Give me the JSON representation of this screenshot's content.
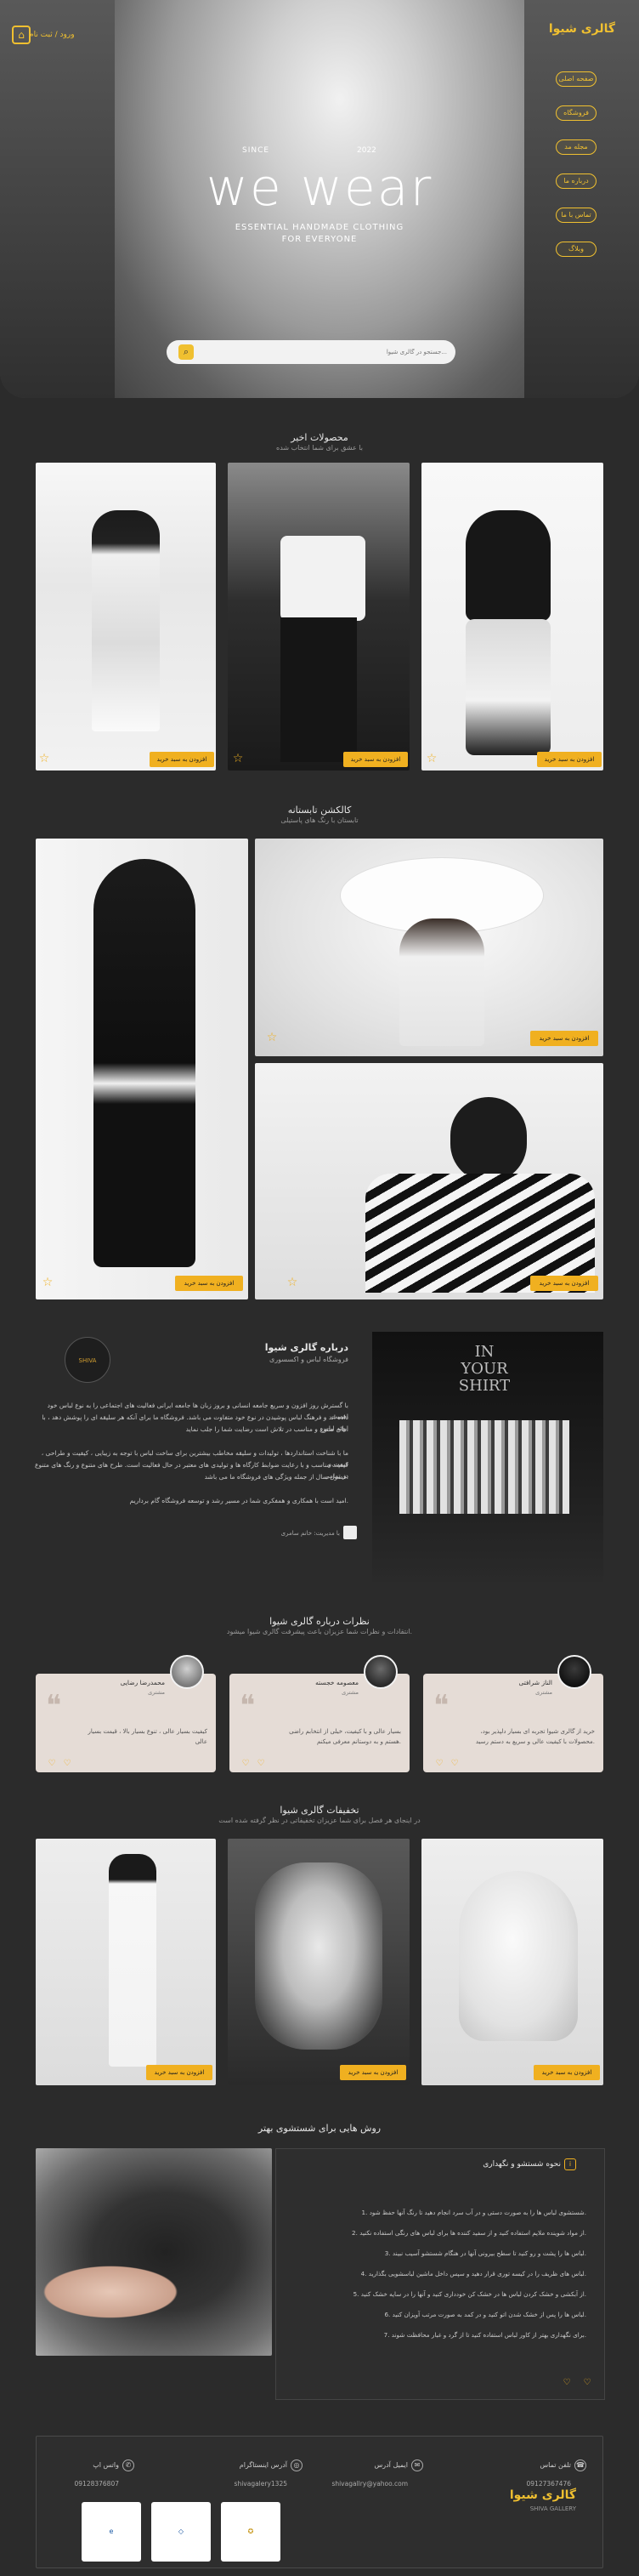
{
  "brand": {
    "name": "گالری شیوا",
    "tagline": "SHIVA"
  },
  "colors": {
    "accent": "#f0b020",
    "bg": "#2b2b2b",
    "card": "#e5dcd6"
  },
  "hero": {
    "signin": "ورود / ثبت نام",
    "cart_icon": "cart-icon",
    "nav": [
      "صفحه اصلی",
      "فروشگاه",
      "مجله مد",
      "درباره ما",
      "تماس با ما",
      "وبلاگ"
    ],
    "since": "SINCE",
    "year": "2022",
    "title": "we wear",
    "sub1": "ESSENTIAL HANDMADE CLOTHING",
    "sub2": "FOR EVERYONE",
    "search_placeholder": "جستجو در گالری شیوا..."
  },
  "latest": {
    "title": "محصولات اخیر",
    "subtitle": "با عشق برای شما انتخاب شده",
    "cta": "افزودن به سبد خرید"
  },
  "collection": {
    "title": "کالکشن تابستانه",
    "subtitle": "تابستان با رنگ های پاستیلی",
    "cta": "افزودن به سبد خرید"
  },
  "about": {
    "logo": "SHIVA",
    "title": "درباره گالری شیوا",
    "subtitle": "فروشگاه لباس و اکسسوری",
    "p1": "با گسترش روز افزون و سریع جامعه انسانی و بروز زبان ها جامعه ایرانی فعالیت های اجتماعی را به نوع لباس خود اهمیت",
    "p2": "داده اند و فرهنگ لباس پوشیدن در نوع خود متفاوت می باشد. فروشگاه ما برای آنکه هر سلیقه ای را پوشش دهد ، با ارائه لباس",
    "p3": "های متنوع و مناسب در تلاش است رضایت شما را جلب نماید.",
    "p4": "ما با شناخت استانداردها ، تولیدات و سلیقه مخاطب بیشترین برای ساخت لباس با توجه به زیبایی ، کیفیت و طراحی ، قیمت و",
    "p5": "کیفیت مناسب و با رعایت ضوابط کارگاه ها و تولیدی های معتبر در حال فعالیت است. طرح های متنوع و رنگ های متنوع در تمامی",
    "p6": "فصول سال از جمله ویژگی های فروشگاه ما می باشد.",
    "p7": "امید است با همکاری و همفکری شما در مسیر رشد و توسعه فروشگاه گام برداریم.",
    "author": "با مدیریت: خانم سامری"
  },
  "comments": {
    "title": "نظرات درباره گالری شیوا",
    "subtitle": "انتقادات و نظرات شما عزیزان باعث پیشرفت گالری شیوا میشود.",
    "items": [
      {
        "name": "الناز شرافتی",
        "role": "مشتری",
        "text": "خرید از گالری شیوا تجربه ای بسیار دلپذیر بود، محصولات با کیفیت عالی و سریع به دستم رسید."
      },
      {
        "name": "معصومه خجسته",
        "role": "مشتری",
        "text": "بسیار عالی و با کیفیت، خیلی از انتخابم راضی هستم و به دوستانم معرفی میکنم."
      },
      {
        "name": "محمدرضا رضایی",
        "role": "مشتری",
        "text": "کیفیت بسیار عالی ، تنوع بسیار بالا ، قیمت بسیار عالی"
      }
    ]
  },
  "discounts": {
    "title": "تخفیفات گالری شیوا",
    "subtitle": "در اینجای هر فصل برای شما عزیزان تخفیفاتی در نظر گرفته شده است",
    "cta": "افزودن به سبد خرید"
  },
  "laundry": {
    "title": "روش هایی برای شستشوی بهتر",
    "box_title": "نحوه شستشو و نگهداری",
    "steps": [
      "1. شستشوی لباس ها را به صورت دستی و در آب سرد انجام دهید تا رنگ آنها حفظ شود.",
      "2. از مواد شوینده ملایم استفاده کنید و از سفید کننده ها برای لباس های رنگی استفاده نکنید.",
      "3. لباس ها را پشت و رو کنید تا سطح بیرونی آنها در هنگام شستشو آسیب نبیند.",
      "4. لباس های ظریف را در کیسه توری قرار دهید و سپس داخل ماشین لباسشویی بگذارید.",
      "5. از آبکشی و خشک کردن لباس ها در خشک کن خودداری کنید و آنها را در سایه خشک کنید.",
      "6. لباس ها را پس از خشک شدن اتو کنید و در کمد به صورت مرتب آویزان کنید.",
      "7. برای نگهداری بهتر از کاور لباس استفاده کنید تا از گرد و غبار محافظت شوند."
    ]
  },
  "footer": {
    "brand": "گالری شیوا",
    "brand_sub": "SHIVA GALLERY",
    "contacts": [
      {
        "label": "تلفن تماس",
        "value": "09127367476",
        "icon": "phone-icon"
      },
      {
        "label": "ایمیل آدرس",
        "value": "shivagallry@yahoo.com",
        "icon": "email-icon"
      },
      {
        "label": "آدرس اینستاگرام",
        "value": "shivagalery1325",
        "icon": "instagram-icon"
      },
      {
        "label": "واتس اپ",
        "value": "09128376807",
        "icon": "whatsapp-icon"
      }
    ],
    "badges": [
      "enamad",
      "samandehi",
      "etehadie"
    ]
  }
}
